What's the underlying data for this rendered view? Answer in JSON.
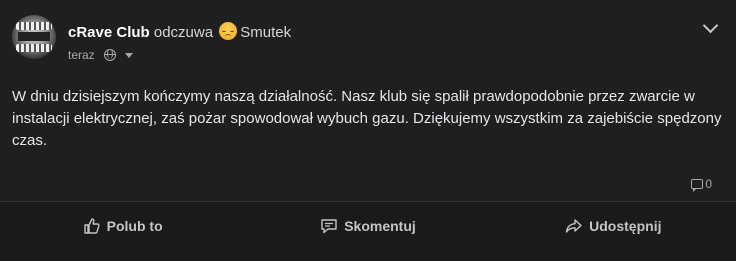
{
  "post": {
    "author": "cRave Club",
    "feeling_prefix": "odczuwa",
    "feeling": "Smutek",
    "feeling_icon": "sad-face-emoji",
    "timestamp": "teraz",
    "privacy_icon": "globe-icon",
    "text": "W dniu dzisiejszym kończymy naszą działalność. Nasz klub się spalił prawdopodobnie przez zwarcie w instalacji elektrycznej, zaś pożar spowodował wybuch gazu. Dziękujemy wszystkim za zajebiście spędzony czas.",
    "comment_count": "0"
  },
  "actions": {
    "like_label": "Polub to",
    "comment_label": "Skomentuj",
    "share_label": "Udostępnij"
  },
  "colors": {
    "background": "#1f1f1f",
    "action_bar": "#1a1a1a",
    "text": "#e4e6eb",
    "muted": "#a8a8a8",
    "emoji": "#f7b32b"
  }
}
